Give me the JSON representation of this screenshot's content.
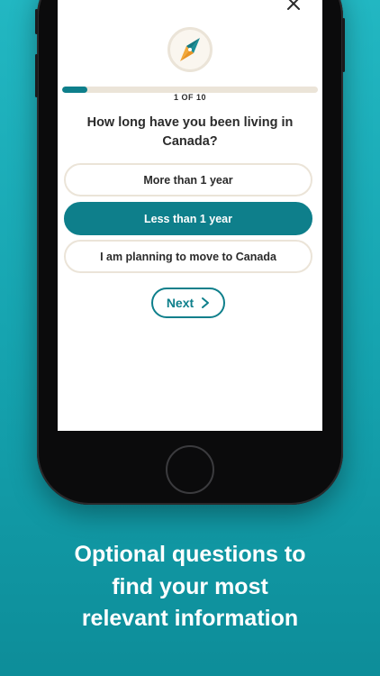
{
  "quiz": {
    "step_label": "1 OF 10",
    "progress": 0.1,
    "question": "How long have you been living in Canada?",
    "options": [
      {
        "label": "More than 1 year",
        "selected": false
      },
      {
        "label": "Less than 1 year",
        "selected": true
      },
      {
        "label": "I am planning to move to Canada",
        "selected": false
      }
    ],
    "next_label": "Next"
  },
  "caption": {
    "lines": [
      "Optional questions to",
      "find your most",
      "relevant information"
    ]
  },
  "colors": {
    "accent": "#0e7f8b",
    "option_border": "#ebe4d8",
    "compass_orange": "#f2a93b",
    "compass_teal": "#1b8f98",
    "background_teal": "#19aab5"
  },
  "icons": [
    "close-icon",
    "compass-icon",
    "chevron-right-icon"
  ]
}
